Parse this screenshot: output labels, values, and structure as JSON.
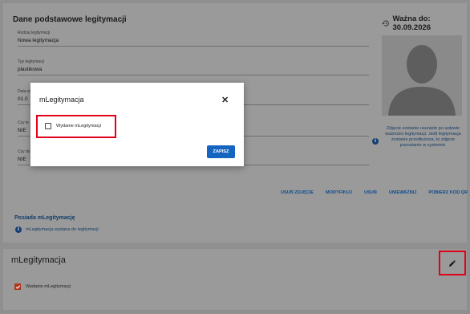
{
  "top_card": {
    "title": "Dane podstawowe legitymacji",
    "valid_until": "Ważna do: 30.09.2026",
    "fields": [
      {
        "label": "Rodzaj legitymacji",
        "value": "Nowa legitymacja"
      },
      {
        "label": "Typ legitymacji",
        "value": "plastikowa"
      },
      {
        "label": "Data w",
        "value": "01.0"
      },
      {
        "label": "Czy le",
        "value": "NIE"
      },
      {
        "label": "Czy du",
        "value": "NIE"
      }
    ],
    "photo_note": "Zdjęcie zostanie usunięte po upływie ważności legitymacji. Jeśli legitymacja zostanie przedłużona, to zdjęcie pozostanie w systemie.",
    "actions": [
      "USUŃ ZDJĘCIE",
      "MODYFIKUJ",
      "USUŃ",
      "UNIEWAŻNIJ",
      "POBIERZ KOD QR"
    ],
    "mleg_heading": "Posiada mLegitymację",
    "mleg_info": "mLegitymacja wydana do legitymacji"
  },
  "bottom_card": {
    "title": "mLegitymacja",
    "checkbox_label": "Wydanie mLegitymacji",
    "checkbox_checked": true
  },
  "modal": {
    "title": "mLegitymacja",
    "checkbox_label": "Wydanie mLegitymacji",
    "checkbox_checked": false,
    "save_label": "ZAPISZ",
    "close_glyph": "✕"
  },
  "colors": {
    "overlay": "#8f8f8f",
    "primary_button": "#1565c0",
    "highlight": "#e0001a",
    "link": "#0d4b8e",
    "checked": "#b0361c"
  },
  "icons": {
    "valid": "history-icon",
    "info": "info-icon",
    "edit": "pencil-icon",
    "close": "close-icon"
  }
}
